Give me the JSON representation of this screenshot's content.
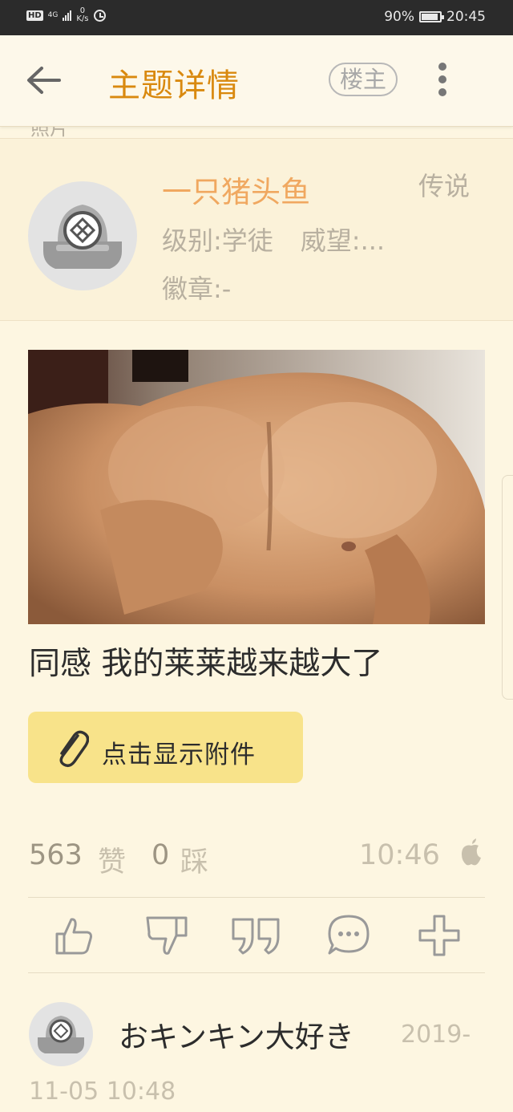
{
  "status_bar": {
    "left_icons": [
      "hd-icon",
      "signal-4g-icon",
      "network-speed-icon",
      "alarm-icon"
    ],
    "network_type": "4G",
    "hd_label": "HD",
    "net_speed_value": "0",
    "net_speed_unit": "K/s",
    "battery": "90%",
    "time": "20:45"
  },
  "app_bar": {
    "title": "主题详情",
    "author_only_label": "楼主",
    "icons": [
      "back-arrow-icon",
      "more-vertical-icon"
    ]
  },
  "hidden_header_text": "照片",
  "user_card": {
    "username": "一只猪头鱼",
    "tag": "传说",
    "level": "级别:学徒",
    "prestige": "威望:...",
    "badge": "徽章:-"
  },
  "post": {
    "image_description_icon": "photo-image",
    "text": "同感 我的莱莱越来越大了",
    "attachment_button_label": "点击显示附件",
    "likes_count": "563",
    "likes_label": "赞",
    "dislikes_count": "0",
    "dislikes_label": "踩",
    "time": "10:46",
    "device_icon": "apple-icon"
  },
  "action_bar": {
    "icons": [
      "thumbs-up-icon",
      "thumbs-down-icon",
      "quote-icon",
      "comment-icon",
      "plus-icon"
    ]
  },
  "reply": {
    "username": "おキンキン大好き",
    "date_part1": "2019-",
    "date_part2": "11-05 10:48"
  },
  "colors": {
    "accent": "#d9890f",
    "username": "#f0a860",
    "background": "#fdf6e1",
    "attachment_button": "#f8e38a"
  }
}
